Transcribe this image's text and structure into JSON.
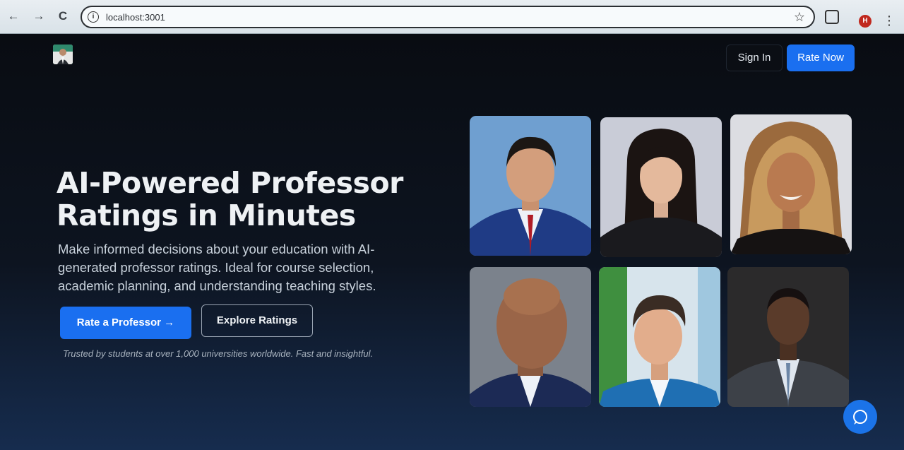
{
  "browser": {
    "url": "localhost:3001",
    "profile_initial": "H",
    "back_icon": "←",
    "forward_icon": "→",
    "reload_icon": "C",
    "star_icon": "☆",
    "menu_icon": "⋮"
  },
  "nav": {
    "signin_label": "Sign In",
    "ratenow_label": "Rate Now"
  },
  "hero": {
    "headline_line1": "AI-Powered Professor",
    "headline_line2": "Ratings in Minutes",
    "subtitle": "Make informed decisions about your education with AI-generated professor ratings. Ideal for course selection, academic planning, and understanding teaching styles.",
    "primary_button": "Rate a Professor →",
    "secondary_button": "Explore Ratings",
    "trusted_text": "Trusted by students at over 1,000 universities worldwide. Fast and insightful."
  },
  "colors": {
    "accent": "#1a6ff0",
    "page_bg": "#0b0f18"
  }
}
